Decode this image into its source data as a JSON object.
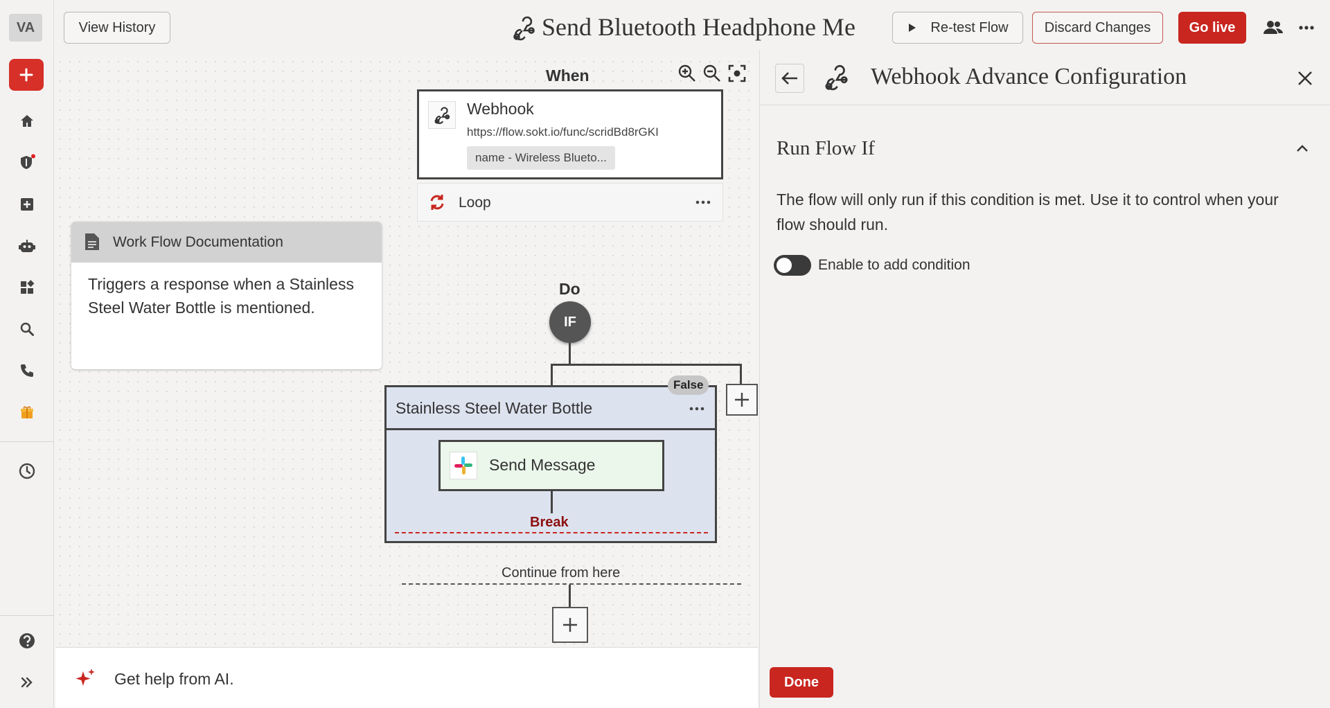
{
  "sidebar": {
    "avatar_initials": "VA",
    "items": [
      {
        "icon": "home-icon"
      },
      {
        "icon": "shield-icon"
      },
      {
        "icon": "add-box-icon"
      },
      {
        "icon": "robot-icon"
      },
      {
        "icon": "dashboard-icon"
      },
      {
        "icon": "search-icon"
      },
      {
        "icon": "phone-icon"
      },
      {
        "icon": "gift-icon"
      },
      {
        "icon": "history-icon"
      }
    ]
  },
  "header": {
    "view_history": "View History",
    "flow_title": "Send Bluetooth Headphone Me",
    "retest": "Re-test Flow",
    "discard": "Discard Changes",
    "go_live": "Go live"
  },
  "canvas": {
    "when_label": "When",
    "trigger": {
      "title": "Webhook",
      "url": "https://flow.sokt.io/func/scridBd8rGKI",
      "chip": "name - Wireless Blueto..."
    },
    "loop_label": "Loop",
    "doc": {
      "title": "Work Flow Documentation",
      "body": "Triggers a response when a Stainless Steel Water Bottle is mentioned."
    },
    "do_label": "Do",
    "if_label": "IF",
    "false_label": "False",
    "branch_title": "Stainless Steel Water Bottle",
    "action_label": "Send Message",
    "break_label": "Break",
    "continue_label": "Continue from here",
    "ai_help": "Get help from AI."
  },
  "panel": {
    "title": "Webhook Advance Configuration",
    "section_title": "Run Flow If",
    "description": "The flow will only run if this condition is met. Use it to control when your flow should run.",
    "toggle_label": "Enable to add condition",
    "toggle_on": false,
    "done": "Done"
  },
  "colors": {
    "accent_red": "#c8261f",
    "branch_bg": "#dde2ef",
    "action_bg": "#eaf7ea"
  }
}
